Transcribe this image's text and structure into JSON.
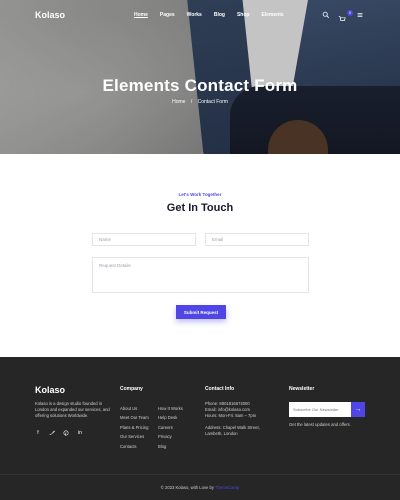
{
  "nav": {
    "logo": "Kolaso",
    "items": [
      "Home",
      "Pages",
      "Works",
      "Blog",
      "Shop",
      "Elements"
    ],
    "cart_count": "0"
  },
  "hero": {
    "title": "Elements Contact Form",
    "breadcrumb": [
      "Home",
      "/",
      "Contact Form"
    ]
  },
  "contact": {
    "kicker": "Let's Work Together",
    "title": "Get In Touch",
    "name_placeholder": "Name",
    "email_placeholder": "Email",
    "details_placeholder": "Request Details",
    "submit_label": "Submit Request"
  },
  "footer": {
    "logo": "Kolaso",
    "about": "Kolaso is a design studio founded in London and expanded our services, and offering solutions Worldwide.",
    "socials": [
      "facebook-icon",
      "twitter-icon",
      "pinterest-icon",
      "linkedin-icon"
    ],
    "company_heading": "Company",
    "company_col1": [
      "About Us",
      "Meet Our Team",
      "Plans & Pricing",
      "Our Services",
      "Contacts"
    ],
    "company_col2": [
      "How It Works",
      "Help Desk",
      "Careers",
      "Privacy",
      "Blog"
    ],
    "contact_heading": "Contact Info",
    "phone": "Phone: 8801816674000",
    "email": "Email: info@kolaso.com",
    "hours": "Hours: Mon-Fri: 8am – 7pm",
    "address_line1": "Address: Chapel Walk Street,",
    "address_line2": "Lambeth, London",
    "newsletter_heading": "Newsletter",
    "newsletter_placeholder": "Subscribe Our Newsletter",
    "newsletter_note": "Get the latest updates and offers.",
    "copyright": "© 2023 Kolaso, with Love by",
    "copyright_brand": "ThemeCamp"
  },
  "colors": {
    "accent": "#4f46e5",
    "footer_bg": "#262626"
  }
}
